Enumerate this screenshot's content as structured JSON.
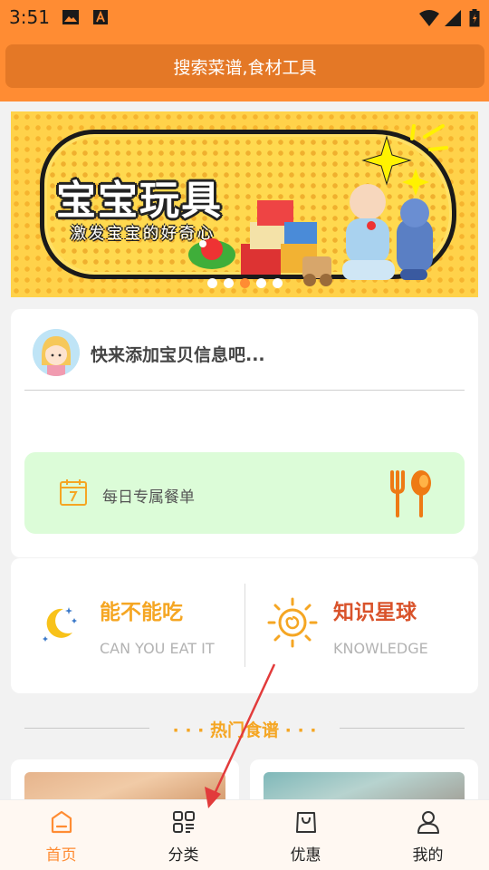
{
  "status_bar": {
    "time": "3:51",
    "icons": [
      "image-icon",
      "text-a-icon",
      "wifi-icon",
      "signal-icon",
      "battery-icon"
    ]
  },
  "search": {
    "placeholder": "搜索菜谱,食材工具"
  },
  "banner": {
    "title": "宝宝玩具",
    "subtitle": "激发宝宝的好奇心",
    "page_count": 5,
    "active_page": 3
  },
  "profile": {
    "prompt": "快来添加宝贝信息吧..."
  },
  "daily_menu": {
    "label": "每日专属餐单"
  },
  "features": [
    {
      "title": "能不能吃",
      "subtitle": "CAN YOU EAT IT",
      "color": "#f5a623"
    },
    {
      "title": "知识星球",
      "subtitle": "KNOWLEDGE",
      "color": "#d9532b"
    }
  ],
  "hot_section": {
    "title": "· · · 热门食谱 · · ·"
  },
  "tabbar": {
    "items": [
      {
        "label": "首页",
        "icon": "home-icon",
        "active": true
      },
      {
        "label": "分类",
        "icon": "category-icon",
        "active": false
      },
      {
        "label": "优惠",
        "icon": "shopping-bag-icon",
        "active": false
      },
      {
        "label": "我的",
        "icon": "user-icon",
        "active": false
      }
    ]
  },
  "colors": {
    "primary": "#ff8c33",
    "search_bg": "#e47826",
    "banner_bg": "#ffd24a",
    "menu_bg": "#dcfcd8",
    "feature_yellow": "#f5a623",
    "feature_red": "#d9532b"
  }
}
